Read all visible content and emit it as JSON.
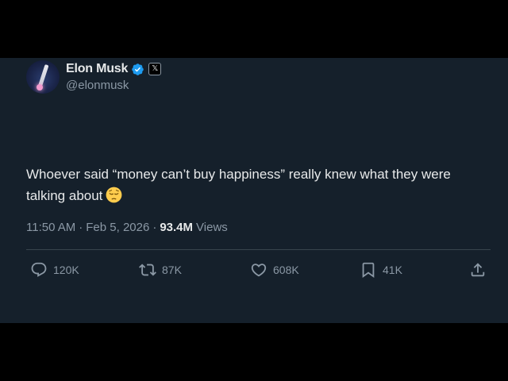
{
  "tweet": {
    "author": {
      "display_name": "Elon Musk",
      "handle": "@elonmusk",
      "verified_color": "#1d9bf0",
      "affiliate_badge": "𝕏"
    },
    "text_line1": "Whoever said “money can’t buy happiness” really knew what they were",
    "text_line2": "talking about",
    "emoji_name": "pensive-face",
    "time": "11:50 AM",
    "separator": "·",
    "date": "Feb 5, 2026",
    "views_count": "93.4M",
    "views_label": "Views"
  },
  "actions": {
    "reply_count": "120K",
    "repost_count": "87K",
    "like_count": "608K",
    "bookmark_count": "41K"
  },
  "colors": {
    "background": "#15202b",
    "text": "#e7e9ea",
    "muted": "#8b98a5",
    "divider": "#38444d"
  }
}
